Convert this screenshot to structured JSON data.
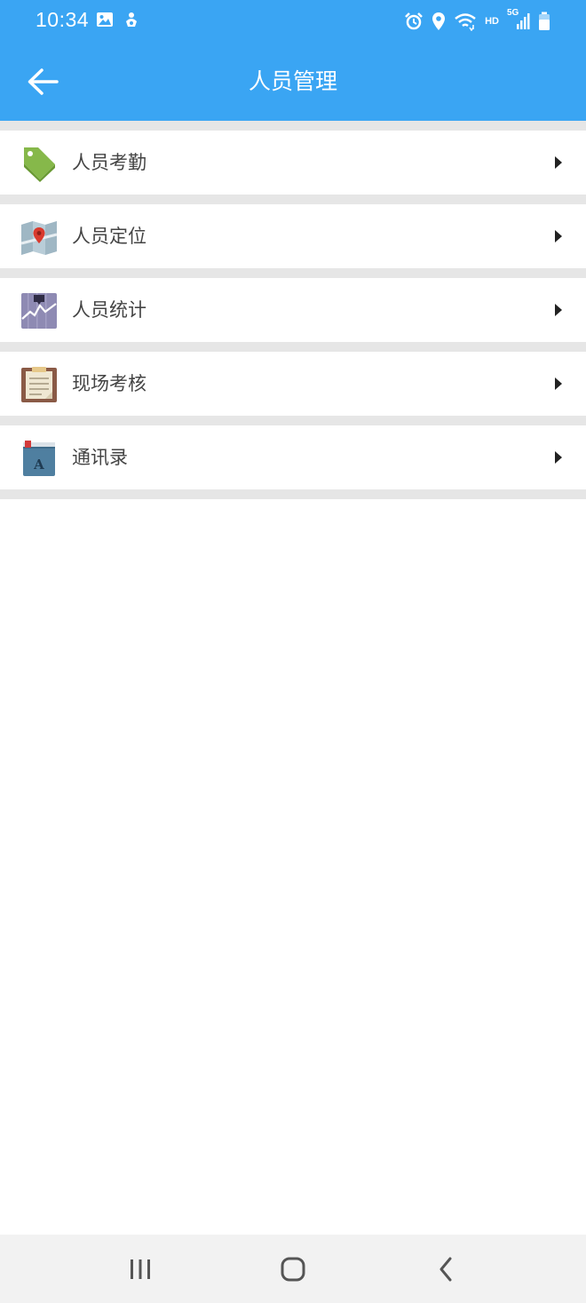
{
  "status_bar": {
    "time": "10:34",
    "network_label": "HD",
    "network_type": "5G",
    "icons_left": [
      "image-icon",
      "sync-icon"
    ],
    "icons_right": [
      "alarm-icon",
      "location-icon",
      "wifi-icon",
      "hd-label",
      "signal-icon",
      "battery-icon"
    ]
  },
  "header": {
    "title": "人员管理",
    "back_icon": "arrow-left-icon"
  },
  "menu": {
    "items": [
      {
        "label": "人员考勤",
        "icon": "tag-icon"
      },
      {
        "label": "人员定位",
        "icon": "map-pin-icon"
      },
      {
        "label": "人员统计",
        "icon": "chart-icon"
      },
      {
        "label": "现场考核",
        "icon": "clipboard-icon"
      },
      {
        "label": "通讯录",
        "icon": "contacts-book-icon"
      }
    ],
    "arrow_icon": "triangle-right-icon"
  },
  "nav_bar": {
    "buttons": [
      "recent-apps-icon",
      "home-icon",
      "back-icon"
    ]
  },
  "colors": {
    "accent": "#3aa5f3",
    "background": "#ffffff",
    "divider": "#e6e6e6",
    "label_text": "#444444"
  }
}
